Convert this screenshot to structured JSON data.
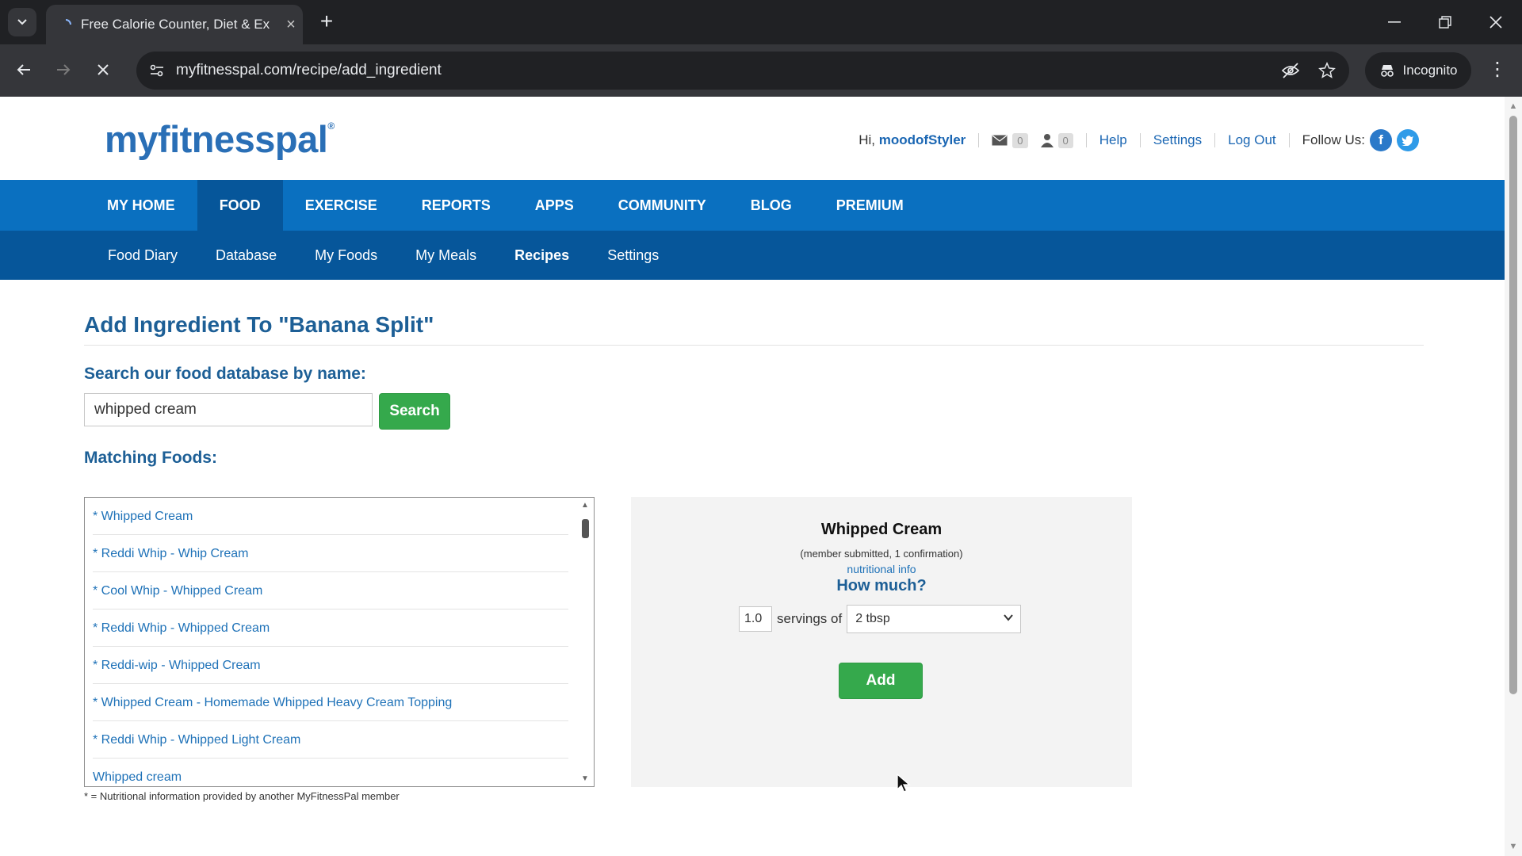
{
  "browser": {
    "tab_title": "Free Calorie Counter, Diet & Ex",
    "url": "myfitnesspal.com/recipe/add_ingredient",
    "incognito_label": "Incognito"
  },
  "header": {
    "logo": "myfitnesspal",
    "greeting": "Hi,",
    "username": "moodofStyler",
    "messages_count": "0",
    "friends_count": "0",
    "help": "Help",
    "settings": "Settings",
    "logout": "Log Out",
    "follow_us": "Follow Us:"
  },
  "main_nav": [
    "MY HOME",
    "FOOD",
    "EXERCISE",
    "REPORTS",
    "APPS",
    "COMMUNITY",
    "BLOG",
    "PREMIUM"
  ],
  "sub_nav": [
    "Food Diary",
    "Database",
    "My Foods",
    "My Meals",
    "Recipes",
    "Settings"
  ],
  "page": {
    "title": "Add Ingredient To \"Banana Split\"",
    "search_label": "Search our food database by name:",
    "search_value": "whipped cream",
    "search_button": "Search",
    "matching_label": "Matching Foods:",
    "results": [
      "* Whipped Cream",
      "* Reddi Whip - Whip Cream",
      "* Cool Whip - Whipped Cream",
      "* Reddi Whip - Whipped Cream",
      "* Reddi-wip - Whipped Cream",
      "* Whipped Cream - Homemade Whipped Heavy Cream Topping",
      "* Reddi Whip - Whipped Light Cream",
      "Whipped cream"
    ],
    "footnote": "* = Nutritional information provided by another MyFitnessPal member"
  },
  "detail": {
    "name": "Whipped Cream",
    "meta": "(member submitted, 1 confirmation)",
    "nutritional_info_link": "nutritional info",
    "how_much": "How much?",
    "quantity": "1.0",
    "servings_of": "servings of",
    "unit": "2 tbsp",
    "add_button": "Add"
  },
  "colors": {
    "nav_blue": "#0a70c0",
    "subnav_blue": "#06569a",
    "title_blue": "#1d5f96",
    "link_blue": "#1f72b8",
    "button_green": "#35a94c"
  }
}
